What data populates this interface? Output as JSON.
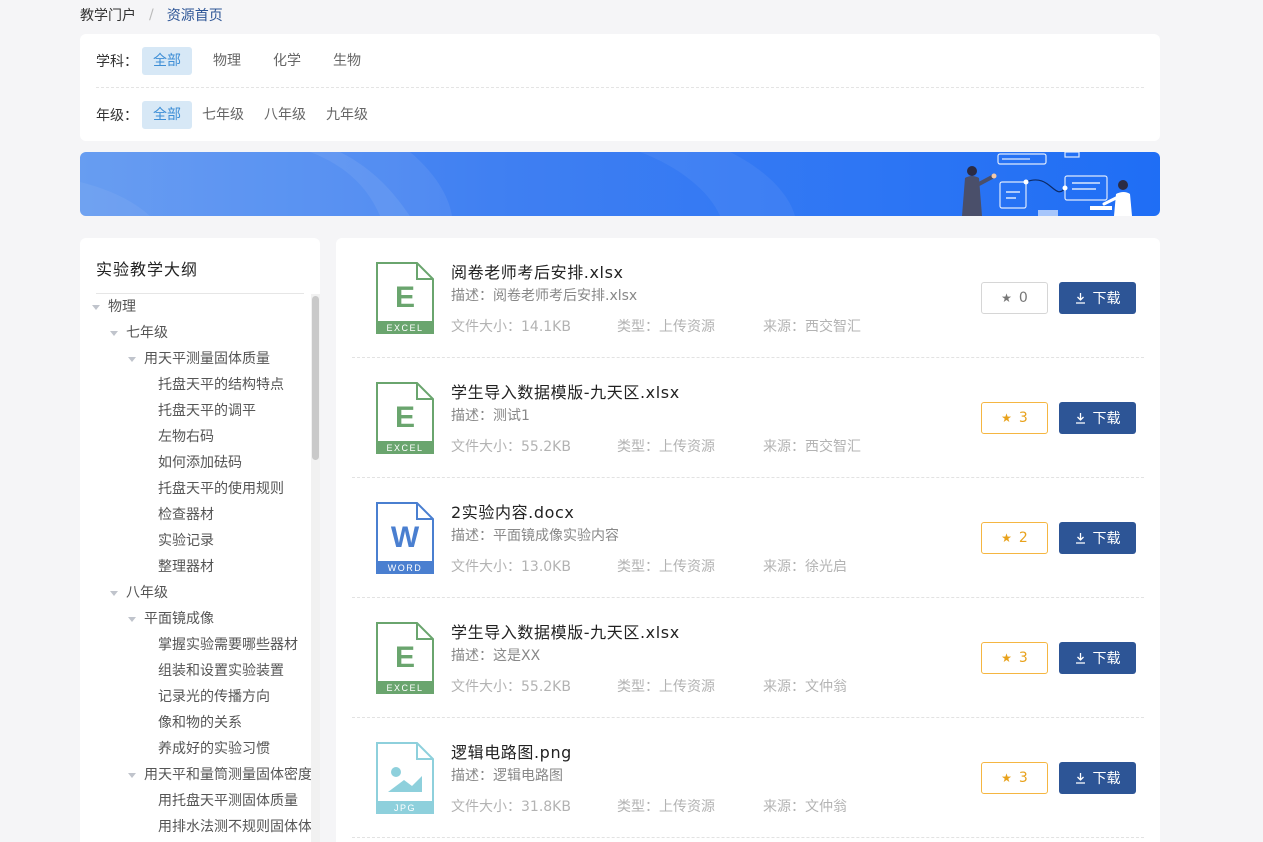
{
  "breadcrumb": {
    "home": "教学门户",
    "separator": "/",
    "current": "资源首页"
  },
  "filters": {
    "subject": {
      "label": "学科：",
      "options": [
        "全部",
        "物理",
        "化学",
        "生物"
      ],
      "selected": 0
    },
    "grade": {
      "label": "年级：",
      "options": [
        "全部",
        "七年级",
        "八年级",
        "九年级"
      ],
      "selected": 0
    }
  },
  "sidebar": {
    "title": "实验教学大纲",
    "tree": [
      {
        "label": "物理",
        "level": 0,
        "expanded": true
      },
      {
        "label": "七年级",
        "level": 1,
        "expanded": true
      },
      {
        "label": "用天平测量固体质量",
        "level": 2,
        "expanded": true
      },
      {
        "label": "托盘天平的结构特点",
        "level": 3
      },
      {
        "label": "托盘天平的调平",
        "level": 3
      },
      {
        "label": "左物右码",
        "level": 3
      },
      {
        "label": "如何添加砝码",
        "level": 3
      },
      {
        "label": "托盘天平的使用规则",
        "level": 3
      },
      {
        "label": "检查器材",
        "level": 3
      },
      {
        "label": "实验记录",
        "level": 3
      },
      {
        "label": "整理器材",
        "level": 3
      },
      {
        "label": "八年级",
        "level": 1,
        "expanded": true
      },
      {
        "label": "平面镜成像",
        "level": 2,
        "expanded": true
      },
      {
        "label": "掌握实验需要哪些器材",
        "level": 3
      },
      {
        "label": "组装和设置实验装置",
        "level": 3
      },
      {
        "label": "记录光的传播方向",
        "level": 3
      },
      {
        "label": "像和物的关系",
        "level": 3
      },
      {
        "label": "养成好的实验习惯",
        "level": 3
      },
      {
        "label": "用天平和量筒测量固体密度",
        "level": 2,
        "expanded": true
      },
      {
        "label": "用托盘天平测固体质量",
        "level": 3
      },
      {
        "label": "用排水法测不规则固体体积",
        "level": 3
      }
    ]
  },
  "resources": [
    {
      "name": "阅卷老师考后安排.xlsx",
      "desc_label": "描述：",
      "desc": "阅卷老师考后安排.xlsx",
      "size_label": "文件大小：",
      "size": "14.1KB",
      "type_label": "类型：",
      "type": "上传资源",
      "source_label": "来源：",
      "source": "西交智汇",
      "stars": "0",
      "file_type": "excel",
      "badge": "EXCEL",
      "letter": "E"
    },
    {
      "name": "学生导入数据模版-九天区.xlsx",
      "desc_label": "描述：",
      "desc": "测试1",
      "size_label": "文件大小：",
      "size": "55.2KB",
      "type_label": "类型：",
      "type": "上传资源",
      "source_label": "来源：",
      "source": "西交智汇",
      "stars": "3",
      "file_type": "excel",
      "badge": "EXCEL",
      "letter": "E"
    },
    {
      "name": "2实验内容.docx",
      "desc_label": "描述：",
      "desc": "平面镜成像实验内容",
      "size_label": "文件大小：",
      "size": "13.0KB",
      "type_label": "类型：",
      "type": "上传资源",
      "source_label": "来源：",
      "source": "徐光启",
      "stars": "2",
      "file_type": "word",
      "badge": "WORD",
      "letter": "W"
    },
    {
      "name": "学生导入数据模版-九天区.xlsx",
      "desc_label": "描述：",
      "desc": "这是XX",
      "size_label": "文件大小：",
      "size": "55.2KB",
      "type_label": "类型：",
      "type": "上传资源",
      "source_label": "来源：",
      "source": "文仲翁",
      "stars": "3",
      "file_type": "excel",
      "badge": "EXCEL",
      "letter": "E"
    },
    {
      "name": "逻辑电路图.png",
      "desc_label": "描述：",
      "desc": "逻辑电路图",
      "size_label": "文件大小：",
      "size": "31.8KB",
      "type_label": "类型：",
      "type": "上传资源",
      "source_label": "来源：",
      "source": "文仲翁",
      "stars": "3",
      "file_type": "image",
      "badge": "JPG",
      "letter": ""
    }
  ],
  "download_label": "下载",
  "icons": {
    "star": "star-icon",
    "download": "download-icon"
  },
  "colors": {
    "primary": "#2d5596",
    "excel": "#6aa56e",
    "word": "#4a7fd0",
    "image": "#8ed0dc",
    "star": "#f5b642",
    "active_filter_bg": "#d7e8f6",
    "active_filter_text": "#3d8ed6"
  }
}
